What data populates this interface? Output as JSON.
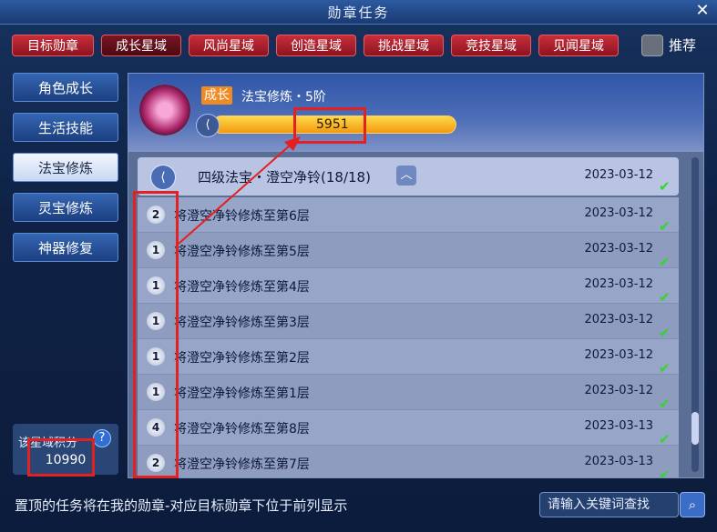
{
  "window": {
    "title": "勋章任务",
    "close_icon": "close-icon"
  },
  "tabs": [
    {
      "label": "目标勋章"
    },
    {
      "label": "成长星域"
    },
    {
      "label": "风尚星域"
    },
    {
      "label": "创造星域"
    },
    {
      "label": "挑战星域"
    },
    {
      "label": "竞技星域"
    },
    {
      "label": "见闻星域"
    }
  ],
  "recommend": {
    "label": "推荐"
  },
  "sidebar": {
    "items": [
      {
        "label": "角色成长"
      },
      {
        "label": "生活技能"
      },
      {
        "label": "法宝修炼"
      },
      {
        "label": "灵宝修炼"
      },
      {
        "label": "神器修复"
      }
    ]
  },
  "points": {
    "label": "该星域积分",
    "value": "10990"
  },
  "header": {
    "badge": "成长",
    "stage": "法宝修炼・5阶",
    "progress_value": "5951"
  },
  "group": {
    "title": "四级法宝・澄空净铃(18/18)",
    "date": "2023-03-12"
  },
  "tasks": [
    {
      "num": "2",
      "text": "将澄空净铃修炼至第6层",
      "date": "2023-03-12"
    },
    {
      "num": "1",
      "text": "将澄空净铃修炼至第5层",
      "date": "2023-03-12"
    },
    {
      "num": "1",
      "text": "将澄空净铃修炼至第4层",
      "date": "2023-03-12"
    },
    {
      "num": "1",
      "text": "将澄空净铃修炼至第3层",
      "date": "2023-03-12"
    },
    {
      "num": "1",
      "text": "将澄空净铃修炼至第2层",
      "date": "2023-03-12"
    },
    {
      "num": "1",
      "text": "将澄空净铃修炼至第1层",
      "date": "2023-03-12"
    },
    {
      "num": "4",
      "text": "将澄空净铃修炼至第8层",
      "date": "2023-03-13"
    },
    {
      "num": "2",
      "text": "将澄空净铃修炼至第7层",
      "date": "2023-03-13"
    }
  ],
  "footer": {
    "note": "置顶的任务将在我的勋章-对应目标勋章下位于前列显示"
  },
  "search": {
    "placeholder": "请输入关键词查找"
  },
  "colors": {
    "tab_red": "#c82e3a",
    "panel_blue": "#2f56a8",
    "check_green": "#2fd82a",
    "highlight_red": "#e52020"
  }
}
